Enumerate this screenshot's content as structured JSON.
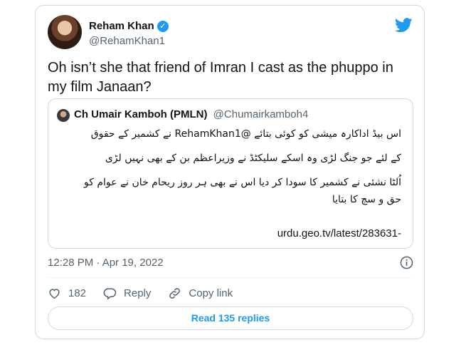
{
  "author": {
    "name": "Reham Khan",
    "handle": "@RehamKhan1",
    "verified_mark": "✓"
  },
  "tweet": {
    "text": "Oh isn’t she that friend of Imran I cast as the phuppo in my film Janaan?",
    "timestamp": "12:28 PM · Apr 19, 2022"
  },
  "quoted_tweet": {
    "name": "Ch Umair Kamboh (PMLN)",
    "handle": "@Chumairkamboh4",
    "lines": [
      "اس بیڈ اداکارہ میشی کو کوئی بتائے @RehamKhan1 نے کشمیر کے حقوق",
      "کے لئے جو جنگ لڑی وہ اسکے سلیکٹڈ نے وزیراعظم بن کے بھی نہیں لڑی",
      "اُلٹا نشئی نے کشمیر کا سودا کر دیا اس نے بھی ہر روز ریحام خان نے عوام کو",
      "حق و سچ کا بتایا"
    ],
    "link": "urdu.geo.tv/latest/283631-"
  },
  "actions": {
    "like_count": "182",
    "reply_label": "Reply",
    "copy_link_label": "Copy link"
  },
  "read_replies_label": "Read 135 replies",
  "colors": {
    "accent": "#1d9bf0",
    "secondary_text": "#536471",
    "border": "#cfd9de",
    "like_icon": "#536471"
  },
  "icons": [
    "twitter-bird-icon",
    "verified-badge-icon",
    "info-icon",
    "heart-icon",
    "reply-icon",
    "link-icon"
  ]
}
